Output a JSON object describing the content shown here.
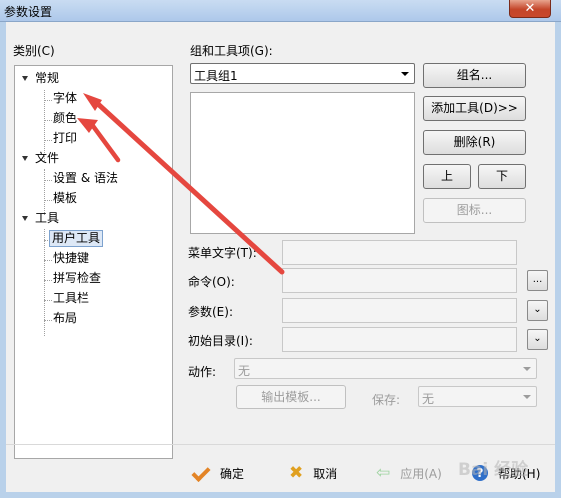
{
  "window": {
    "title": "参数设置",
    "close_glyph": "✕"
  },
  "tree": {
    "label": "类别(C)",
    "nodes": [
      {
        "label": "常规",
        "children": [
          "字体",
          "颜色",
          "打印"
        ]
      },
      {
        "label": "文件",
        "children": [
          "设置 & 语法",
          "模板"
        ]
      },
      {
        "label": "工具",
        "children": [
          "用户工具",
          "快捷键",
          "拼写检查",
          "工具栏",
          "布局"
        ]
      }
    ],
    "selected": "用户工具"
  },
  "group": {
    "label": "组和工具项(G):",
    "combo_value": "工具组1",
    "list_items": []
  },
  "buttons": {
    "group_name": "组名...",
    "add_tool": "添加工具(D)>>",
    "delete": "删除(R)",
    "up": "上",
    "down": "下",
    "icon": "图标...",
    "export_template": "输出模板...",
    "browse_glyph": "...",
    "dropdown_glyph": "⌄"
  },
  "fields": {
    "menu_text": {
      "label": "菜单文字(T):",
      "value": ""
    },
    "command": {
      "label": "命令(O):",
      "value": ""
    },
    "params": {
      "label": "参数(E):",
      "value": ""
    },
    "init_dir": {
      "label": "初始目录(I):",
      "value": ""
    },
    "action": {
      "label": "动作:",
      "value": "无"
    },
    "save": {
      "label": "保存:",
      "value": "无"
    }
  },
  "footer": {
    "ok": "确定",
    "cancel": "取消",
    "apply": "应用(A)",
    "help": "帮助(H)"
  },
  "watermark": "Bai 经验",
  "annotation": {
    "arrow_color": "#e5473f"
  }
}
